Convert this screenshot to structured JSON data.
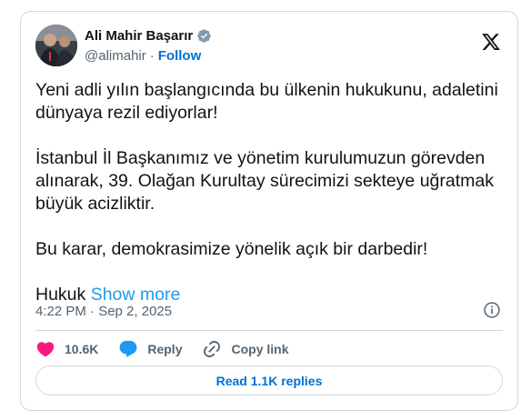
{
  "author": {
    "name": "Ali Mahir Başarır",
    "handle": "@alimahir",
    "separator": "·",
    "follow_label": "Follow"
  },
  "tweet": {
    "paragraphs": [
      "Yeni adli yılın başlangıcında bu ülkenin hukukunu, adaletini dünyaya rezil ediyorlar!",
      "İstanbul İl Başkanımız ve yönetim kurulumuzun görevden alınarak, 39. Olağan Kurultay sürecimizi sekteye uğratmak büyük acizliktir.",
      "Bu karar, demokrasimize yönelik açık bir darbedir!"
    ],
    "truncated_text": "Hukuk",
    "show_more_label": "Show more",
    "timestamp": "4:22 PM · Sep 2, 2025"
  },
  "actions": {
    "like_count": "10.6K",
    "reply_label": "Reply",
    "copy_link_label": "Copy link"
  },
  "read_replies_label": "Read 1.1K replies",
  "icons": {
    "verified": "verified-badge-icon",
    "platform": "x-logo-icon",
    "info": "info-icon",
    "like": "heart-icon",
    "reply": "speech-bubble-icon",
    "link": "link-icon"
  },
  "colors": {
    "link": "#1d9bf0",
    "follow": "#006fd6",
    "like": "#f91880",
    "reply": "#1d9bf0",
    "muted": "#536471",
    "border": "#cfd9de"
  }
}
